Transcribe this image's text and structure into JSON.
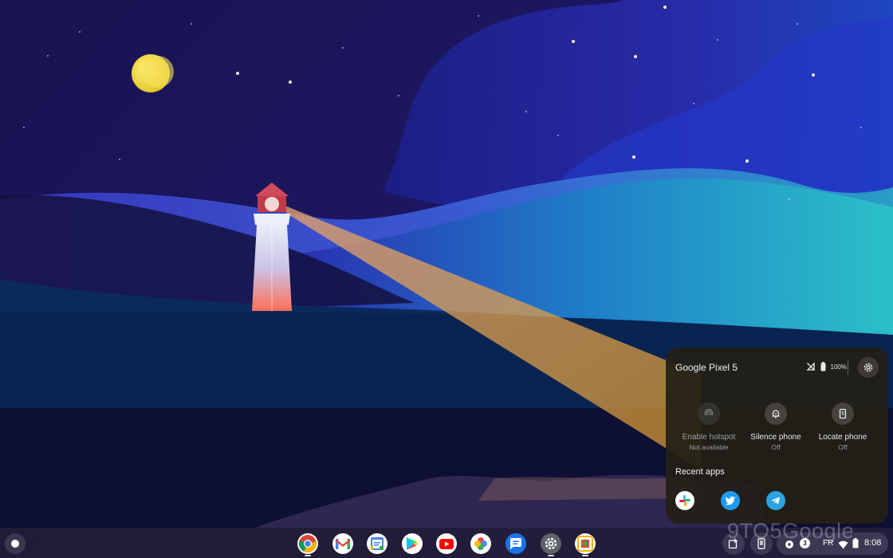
{
  "phone_hub": {
    "device_name": "Google Pixel 5",
    "battery": "100%",
    "tiles": [
      {
        "label": "Enable hotspot",
        "status": "Not available"
      },
      {
        "label": "Silence phone",
        "status": "Off"
      },
      {
        "label": "Locate phone",
        "status": "Off"
      }
    ],
    "recent_apps_title": "Recent apps"
  },
  "shelf": {
    "tray": {
      "notification_count": "3",
      "language": "FR",
      "time": "8:08"
    }
  },
  "watermark": "9TO5Google"
}
